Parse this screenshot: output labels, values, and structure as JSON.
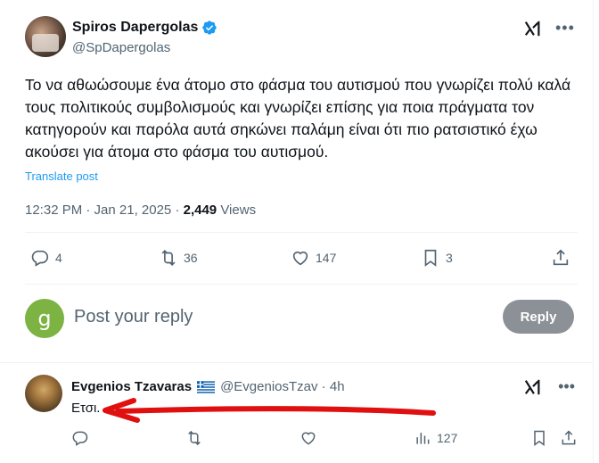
{
  "post": {
    "author_name": "Spiros Dapergolas",
    "author_handle": "@SpDapergolas",
    "text": "Το να αθωώσουμε ένα άτομο στο φάσμα του αυτισμού που γνωρίζει πολύ καλά τους πολιτικούς συμβολισμούς και γνωρίζει επίσης για ποια πράγματα τον κατηγορούν και παρόλα αυτά σηκώνει παλάμη είναι ότι πιο ρατσιστικό έχω ακούσει για άτομα στο φάσμα του αυτισμού.",
    "translate_label": "Translate post",
    "time": "12:32 PM · Jan 21, 2025 · ",
    "views_count": "2,449",
    "views_label": " Views",
    "actions": {
      "replies": "4",
      "reposts": "36",
      "likes": "147",
      "bookmarks": "3"
    }
  },
  "reply_composer": {
    "avatar_letter": "g",
    "placeholder": "Post your reply",
    "button_label": "Reply"
  },
  "reply": {
    "author_name": "Evgenios Tzavaras",
    "author_handle": "@EvgeniosTzav · 4h",
    "text": "Ετσι.",
    "views": "127"
  },
  "colors": {
    "accent": "#1d9bf0",
    "muted": "#536471",
    "reply_button": "#8b9196",
    "composer_avatar": "#7cb342",
    "annotation_arrow": "#e01010"
  }
}
